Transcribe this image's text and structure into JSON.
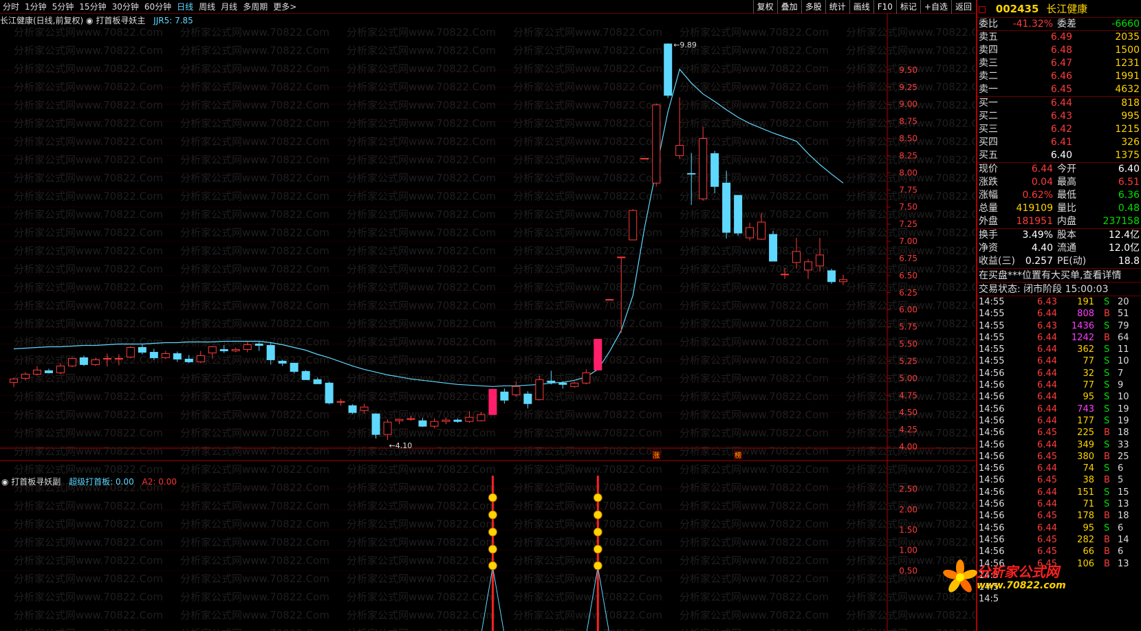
{
  "periods": [
    "分时",
    "1分钟",
    "5分钟",
    "15分钟",
    "30分钟",
    "60分钟",
    "日线",
    "周线",
    "月线",
    "多周期",
    "更多>"
  ],
  "active_period": "日线",
  "tools": [
    "复权",
    "叠加",
    "多股",
    "统计",
    "画线",
    "F10",
    "标记",
    "+自选",
    "返回"
  ],
  "main_info": {
    "stock": "长江健康(日线,前复权)",
    "indicator": "打首板寻妖主",
    "jjr_label": "JJR5:",
    "jjr_value": "7.85"
  },
  "sub_info": {
    "name": "打首板寻妖副",
    "line1": "超级打首板: 0.00",
    "line2": "A2: 0.00"
  },
  "watermark": "分析家公式网www.70822.Com",
  "chart_data": {
    "type": "candlestick",
    "ylim": [
      4.0,
      10.0
    ],
    "yticks": [
      4.0,
      4.25,
      4.5,
      4.75,
      5.0,
      5.25,
      5.5,
      5.75,
      6.0,
      6.25,
      6.5,
      6.75,
      7.0,
      7.25,
      7.5,
      7.75,
      8.0,
      8.25,
      8.5,
      8.75,
      9.0,
      9.25,
      9.5
    ],
    "sub_ylim": [
      0,
      3.0
    ],
    "sub_yticks": [
      0.5,
      1.0,
      1.5,
      2.0,
      2.5
    ],
    "high_label": "9.89",
    "low_label": "4.10",
    "ma_name": "JJR5",
    "candles": [
      {
        "o": 4.94,
        "h": 5.01,
        "l": 4.87,
        "c": 4.99
      },
      {
        "o": 5.0,
        "h": 5.09,
        "l": 4.97,
        "c": 5.06
      },
      {
        "o": 5.06,
        "h": 5.18,
        "l": 5.04,
        "c": 5.12
      },
      {
        "o": 5.11,
        "h": 5.14,
        "l": 5.07,
        "c": 5.08
      },
      {
        "o": 5.08,
        "h": 5.22,
        "l": 5.06,
        "c": 5.18
      },
      {
        "o": 5.18,
        "h": 5.31,
        "l": 5.16,
        "c": 5.29
      },
      {
        "o": 5.3,
        "h": 5.33,
        "l": 5.18,
        "c": 5.2
      },
      {
        "o": 5.2,
        "h": 5.3,
        "l": 5.18,
        "c": 5.27
      },
      {
        "o": 5.29,
        "h": 5.36,
        "l": 5.17,
        "c": 5.29
      },
      {
        "o": 5.29,
        "h": 5.35,
        "l": 5.19,
        "c": 5.29
      },
      {
        "o": 5.31,
        "h": 5.47,
        "l": 5.29,
        "c": 5.45
      },
      {
        "o": 5.45,
        "h": 5.49,
        "l": 5.35,
        "c": 5.38
      },
      {
        "o": 5.38,
        "h": 5.43,
        "l": 5.27,
        "c": 5.3
      },
      {
        "o": 5.3,
        "h": 5.4,
        "l": 5.28,
        "c": 5.36
      },
      {
        "o": 5.36,
        "h": 5.39,
        "l": 5.24,
        "c": 5.28
      },
      {
        "o": 5.28,
        "h": 5.34,
        "l": 5.22,
        "c": 5.24
      },
      {
        "o": 5.24,
        "h": 5.4,
        "l": 5.22,
        "c": 5.33
      },
      {
        "o": 5.37,
        "h": 5.47,
        "l": 5.29,
        "c": 5.46
      },
      {
        "o": 5.42,
        "h": 5.48,
        "l": 5.37,
        "c": 5.4
      },
      {
        "o": 5.4,
        "h": 5.45,
        "l": 5.38,
        "c": 5.42
      },
      {
        "o": 5.42,
        "h": 5.53,
        "l": 5.38,
        "c": 5.49
      },
      {
        "o": 5.5,
        "h": 5.53,
        "l": 5.4,
        "c": 5.48
      },
      {
        "o": 5.48,
        "h": 5.53,
        "l": 5.2,
        "c": 5.27
      },
      {
        "o": 5.25,
        "h": 5.27,
        "l": 5.18,
        "c": 5.22
      },
      {
        "o": 5.22,
        "h": 5.23,
        "l": 5.07,
        "c": 5.1
      },
      {
        "o": 5.1,
        "h": 5.12,
        "l": 4.98,
        "c": 4.98
      },
      {
        "o": 4.98,
        "h": 5.01,
        "l": 4.92,
        "c": 4.92
      },
      {
        "o": 4.93,
        "h": 4.95,
        "l": 4.62,
        "c": 4.64
      },
      {
        "o": 4.65,
        "h": 4.7,
        "l": 4.6,
        "c": 4.66
      },
      {
        "o": 4.6,
        "h": 4.62,
        "l": 4.48,
        "c": 4.5
      },
      {
        "o": 4.53,
        "h": 4.63,
        "l": 4.49,
        "c": 4.58
      },
      {
        "o": 4.48,
        "h": 4.49,
        "l": 4.12,
        "c": 4.18
      },
      {
        "o": 4.18,
        "h": 4.4,
        "l": 4.1,
        "c": 4.36
      },
      {
        "o": 4.38,
        "h": 4.41,
        "l": 4.33,
        "c": 4.4
      },
      {
        "o": 4.4,
        "h": 4.45,
        "l": 4.38,
        "c": 4.41
      },
      {
        "o": 4.38,
        "h": 4.42,
        "l": 4.29,
        "c": 4.3
      },
      {
        "o": 4.3,
        "h": 4.41,
        "l": 4.27,
        "c": 4.37
      },
      {
        "o": 4.37,
        "h": 4.42,
        "l": 4.33,
        "c": 4.39
      },
      {
        "o": 4.39,
        "h": 4.41,
        "l": 4.35,
        "c": 4.37
      },
      {
        "o": 4.37,
        "h": 4.52,
        "l": 4.35,
        "c": 4.43
      },
      {
        "o": 4.38,
        "h": 4.51,
        "l": 4.37,
        "c": 4.47
      },
      {
        "o": 4.47,
        "h": 4.84,
        "l": 4.46,
        "c": 4.84
      },
      {
        "o": 4.8,
        "h": 4.85,
        "l": 4.63,
        "c": 4.68
      },
      {
        "o": 4.76,
        "h": 4.95,
        "l": 4.73,
        "c": 4.88
      },
      {
        "o": 4.77,
        "h": 4.81,
        "l": 4.56,
        "c": 4.63
      },
      {
        "o": 4.69,
        "h": 5.04,
        "l": 4.68,
        "c": 4.98
      },
      {
        "o": 4.96,
        "h": 5.11,
        "l": 4.91,
        "c": 4.94
      },
      {
        "o": 4.93,
        "h": 4.96,
        "l": 4.85,
        "c": 4.91
      },
      {
        "o": 4.88,
        "h": 4.95,
        "l": 4.86,
        "c": 4.93
      },
      {
        "o": 4.93,
        "h": 5.13,
        "l": 4.91,
        "c": 5.08
      },
      {
        "o": 5.12,
        "h": 5.57,
        "l": 5.12,
        "c": 5.57
      },
      {
        "o": 6.15,
        "h": 6.15,
        "l": 6.15,
        "c": 6.15
      },
      {
        "o": 6.77,
        "h": 6.77,
        "l": 5.66,
        "c": 6.77
      },
      {
        "o": 7.02,
        "h": 7.47,
        "l": 7.02,
        "c": 7.45
      },
      {
        "o": 8.21,
        "h": 8.21,
        "l": 8.21,
        "c": 8.21
      },
      {
        "o": 7.85,
        "h": 9.01,
        "l": 7.8,
        "c": 8.99
      },
      {
        "o": 9.88,
        "h": 9.89,
        "l": 9.09,
        "c": 9.13
      },
      {
        "o": 8.25,
        "h": 9.1,
        "l": 8.2,
        "c": 8.4
      },
      {
        "o": 7.99,
        "h": 8.29,
        "l": 7.53,
        "c": 7.98
      },
      {
        "o": 7.62,
        "h": 8.67,
        "l": 7.59,
        "c": 8.5
      },
      {
        "o": 8.28,
        "h": 8.32,
        "l": 7.7,
        "c": 7.8
      },
      {
        "o": 7.85,
        "h": 8.03,
        "l": 7.04,
        "c": 7.13
      },
      {
        "o": 7.67,
        "h": 7.67,
        "l": 7.08,
        "c": 7.12
      },
      {
        "o": 7.05,
        "h": 7.27,
        "l": 7.01,
        "c": 7.2
      },
      {
        "o": 7.03,
        "h": 7.41,
        "l": 7.02,
        "c": 7.28
      },
      {
        "o": 7.1,
        "h": 7.15,
        "l": 6.73,
        "c": 6.71
      },
      {
        "o": 6.52,
        "h": 6.61,
        "l": 6.45,
        "c": 6.52
      },
      {
        "o": 6.69,
        "h": 7.05,
        "l": 6.6,
        "c": 6.85
      },
      {
        "o": 6.58,
        "h": 6.74,
        "l": 6.45,
        "c": 6.7
      },
      {
        "o": 6.64,
        "h": 7.05,
        "l": 6.56,
        "c": 6.8
      },
      {
        "o": 6.57,
        "h": 6.6,
        "l": 6.38,
        "c": 6.41
      },
      {
        "o": 6.41,
        "h": 6.51,
        "l": 6.36,
        "c": 6.44
      }
    ],
    "ma": [
      5.43,
      5.44,
      5.45,
      5.46,
      5.46,
      5.47,
      5.48,
      5.48,
      5.49,
      5.5,
      5.5,
      5.5,
      5.51,
      5.52,
      5.52,
      5.53,
      5.53,
      5.53,
      5.54,
      5.54,
      5.54,
      5.54,
      5.52,
      5.49,
      5.45,
      5.41,
      5.35,
      5.3,
      5.24,
      5.18,
      5.13,
      5.09,
      5.05,
      5.02,
      4.99,
      4.97,
      4.95,
      4.93,
      4.91,
      4.9,
      4.89,
      4.88,
      4.89,
      4.89,
      4.9,
      4.91,
      4.93,
      4.94,
      4.97,
      5.02,
      5.13,
      5.39,
      5.7,
      6.21,
      7.2,
      8.05,
      8.89,
      9.51,
      9.31,
      9.15,
      9.04,
      8.92,
      8.81,
      8.72,
      8.65,
      8.58,
      8.52,
      8.46,
      8.28,
      8.12,
      7.98,
      7.85
    ],
    "ma_start": 0,
    "red_bar_index": 41,
    "pink_bar_index": 50,
    "markers": [
      {
        "index": 55,
        "text": "涨"
      },
      {
        "index": 62,
        "text": "榜"
      }
    ],
    "signal_indices": [
      41,
      50
    ]
  },
  "quote": {
    "code": "002435",
    "name": "长江健康",
    "weibi_label": "委比",
    "weibi": "-41.32%",
    "weicha_label": "委差",
    "weicha": "-6660",
    "asks": [
      {
        "label": "卖五",
        "price": "6.49",
        "vol": "2035"
      },
      {
        "label": "卖四",
        "price": "6.48",
        "vol": "1500"
      },
      {
        "label": "卖三",
        "price": "6.47",
        "vol": "1231"
      },
      {
        "label": "卖二",
        "price": "6.46",
        "vol": "1991"
      },
      {
        "label": "卖一",
        "price": "6.45",
        "vol": "4632"
      }
    ],
    "bids": [
      {
        "label": "买一",
        "price": "6.44",
        "vol": "818",
        "color": "red"
      },
      {
        "label": "买二",
        "price": "6.43",
        "vol": "995",
        "color": "red"
      },
      {
        "label": "买三",
        "price": "6.42",
        "vol": "1215",
        "color": "red"
      },
      {
        "label": "买四",
        "price": "6.41",
        "vol": "326",
        "color": "red"
      },
      {
        "label": "买五",
        "price": "6.40",
        "vol": "1375",
        "color": "white"
      }
    ],
    "stats": [
      {
        "l1": "现价",
        "v1": "6.44",
        "c1": "red",
        "l2": "今开",
        "v2": "6.40",
        "c2": "white"
      },
      {
        "l1": "涨跌",
        "v1": "0.04",
        "c1": "red",
        "l2": "最高",
        "v2": "6.51",
        "c2": "red"
      },
      {
        "l1": "涨幅",
        "v1": "0.62%",
        "c1": "red",
        "l2": "最低",
        "v2": "6.36",
        "c2": "green"
      },
      {
        "l1": "总量",
        "v1": "419109",
        "c1": "yellow",
        "l2": "量比",
        "v2": "0.48",
        "c2": "green"
      },
      {
        "l1": "外盘",
        "v1": "181951",
        "c1": "red",
        "l2": "内盘",
        "v2": "237158",
        "c2": "green"
      }
    ],
    "stats2": [
      {
        "l1": "换手",
        "v1": "3.49%",
        "l2": "股本",
        "v2": "12.4亿"
      },
      {
        "l1": "净资",
        "v1": "4.40",
        "l2": "流通",
        "v2": "12.0亿"
      },
      {
        "l1": "收益(三)",
        "v1": "0.257",
        "l2": "PE(动)",
        "v2": "18.8"
      }
    ],
    "message": "在买盘***位置有大买单,查看详情",
    "trade_status": "交易状态: 闭市阶段 15:00:03",
    "ticks": [
      {
        "t": "14:55",
        "p": "6.43",
        "v": "191",
        "bs": "S",
        "n": "20"
      },
      {
        "t": "14:55",
        "p": "6.44",
        "v": "808",
        "bs": "B",
        "n": "51"
      },
      {
        "t": "14:55",
        "p": "6.43",
        "v": "1436",
        "bs": "S",
        "n": "79"
      },
      {
        "t": "14:55",
        "p": "6.44",
        "v": "1242",
        "bs": "B",
        "n": "64"
      },
      {
        "t": "14:55",
        "p": "6.44",
        "v": "362",
        "bs": "S",
        "n": "11"
      },
      {
        "t": "14:55",
        "p": "6.44",
        "v": "77",
        "bs": "S",
        "n": "10"
      },
      {
        "t": "14:56",
        "p": "6.44",
        "v": "32",
        "bs": "S",
        "n": "7"
      },
      {
        "t": "14:56",
        "p": "6.44",
        "v": "77",
        "bs": "S",
        "n": "9"
      },
      {
        "t": "14:56",
        "p": "6.44",
        "v": "95",
        "bs": "S",
        "n": "10"
      },
      {
        "t": "14:56",
        "p": "6.44",
        "v": "743",
        "bs": "S",
        "n": "19"
      },
      {
        "t": "14:56",
        "p": "6.44",
        "v": "177",
        "bs": "S",
        "n": "19"
      },
      {
        "t": "14:56",
        "p": "6.45",
        "v": "225",
        "bs": "B",
        "n": "18"
      },
      {
        "t": "14:56",
        "p": "6.44",
        "v": "349",
        "bs": "S",
        "n": "33"
      },
      {
        "t": "14:56",
        "p": "6.45",
        "v": "380",
        "bs": "B",
        "n": "25"
      },
      {
        "t": "14:56",
        "p": "6.44",
        "v": "74",
        "bs": "S",
        "n": "6"
      },
      {
        "t": "14:56",
        "p": "6.45",
        "v": "38",
        "bs": "B",
        "n": "5"
      },
      {
        "t": "14:56",
        "p": "6.44",
        "v": "151",
        "bs": "S",
        "n": "15"
      },
      {
        "t": "14:56",
        "p": "6.44",
        "v": "71",
        "bs": "S",
        "n": "13"
      },
      {
        "t": "14:56",
        "p": "6.45",
        "v": "178",
        "bs": "B",
        "n": "18"
      },
      {
        "t": "14:56",
        "p": "6.44",
        "v": "95",
        "bs": "S",
        "n": "6"
      },
      {
        "t": "14:56",
        "p": "6.45",
        "v": "282",
        "bs": "B",
        "n": "14"
      },
      {
        "t": "14:56",
        "p": "6.45",
        "v": "66",
        "bs": "B",
        "n": "6"
      },
      {
        "t": "14:56",
        "p": "6.45",
        "v": "106",
        "bs": "B",
        "n": "13"
      },
      {
        "t": "14:5",
        "p": "",
        "v": "",
        "bs": "",
        "n": ""
      },
      {
        "t": "14:5",
        "p": "",
        "v": "",
        "bs": "",
        "n": ""
      },
      {
        "t": "14:5",
        "p": "",
        "v": "",
        "bs": "",
        "n": ""
      }
    ]
  },
  "logo": {
    "text": "分析家公式网",
    "url": "www.70822.com"
  }
}
